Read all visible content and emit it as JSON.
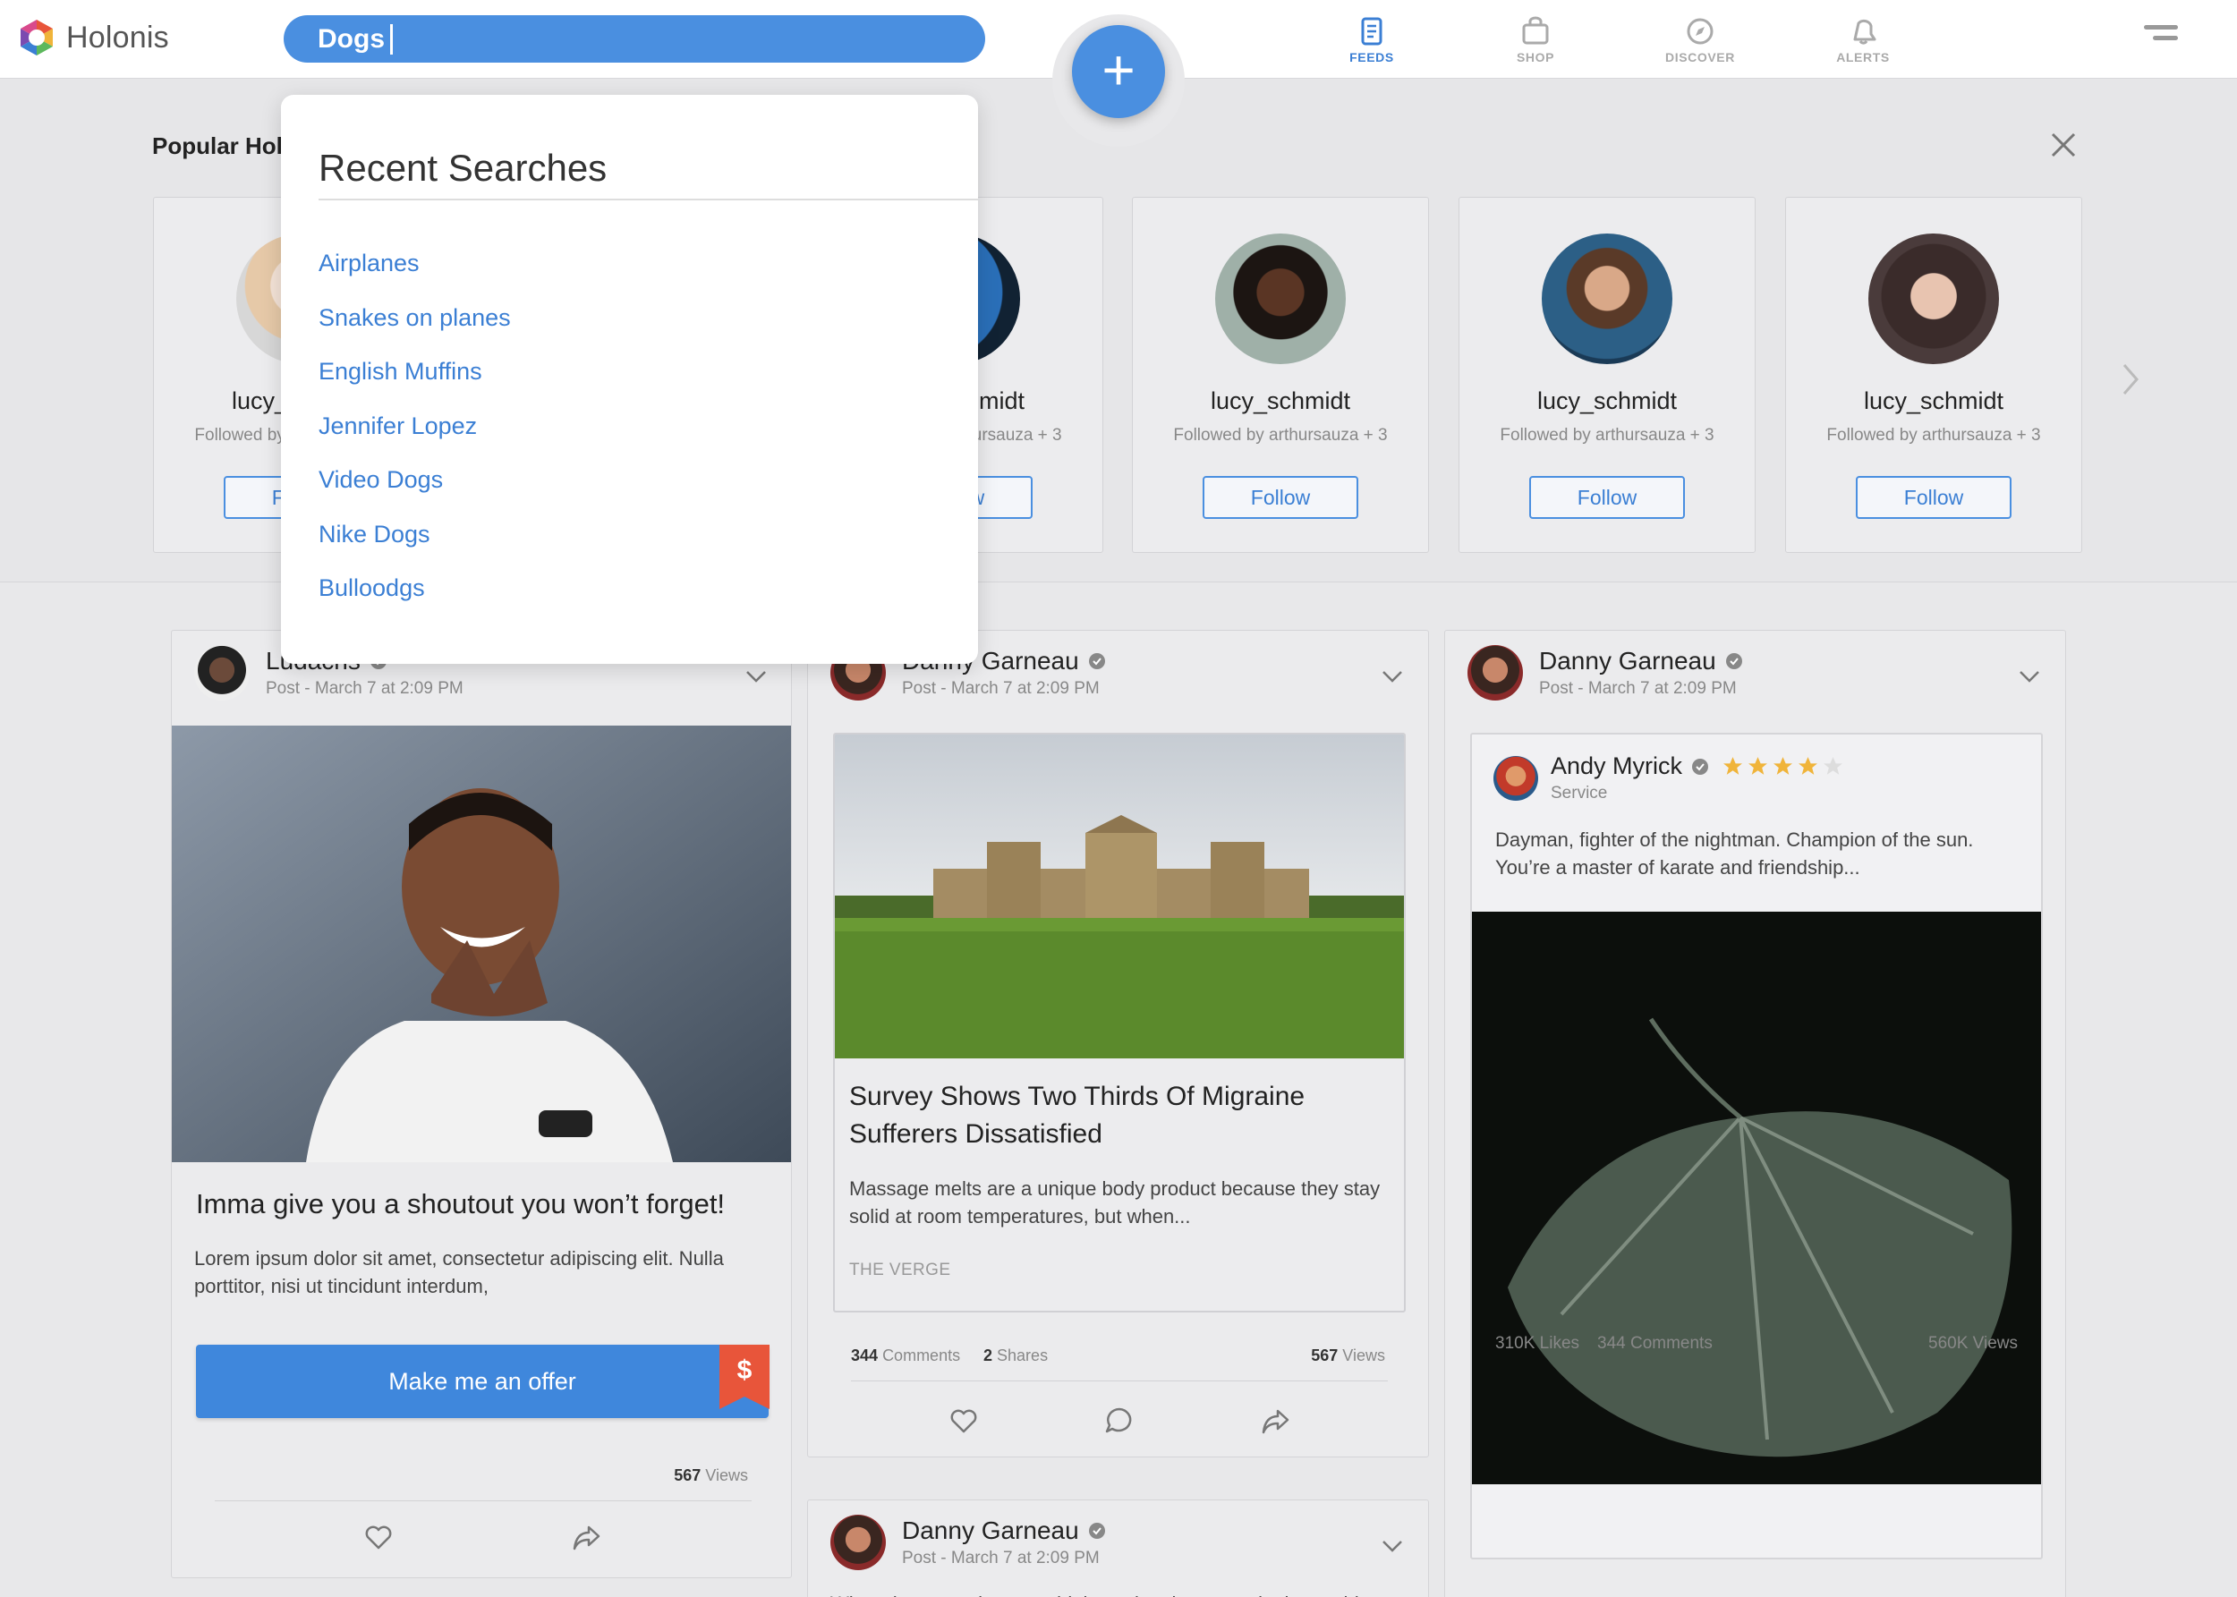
{
  "app": {
    "name": "Holonis"
  },
  "search": {
    "query": "Dogs"
  },
  "fab": {
    "label": "+"
  },
  "nav": [
    {
      "label": "FEEDS",
      "icon": "feeds-icon",
      "active": true
    },
    {
      "label": "SHOP",
      "icon": "shop-icon",
      "active": false
    },
    {
      "label": "DISCOVER",
      "icon": "discover-icon",
      "active": false
    },
    {
      "label": "ALERTS",
      "icon": "alerts-icon",
      "active": false
    }
  ],
  "popular": {
    "title": "Popular Holonis Users",
    "users": [
      {
        "name": "lucy_schmidt",
        "followed": "Followed by arthursauza + 3",
        "follow_label": "Follow"
      },
      {
        "name": "lucy_schmidt",
        "followed": "Followed by arthursauza + 3",
        "follow_label": "Follow"
      },
      {
        "name": "lucy_schmidt",
        "followed": "Followed by arthursauza + 3",
        "follow_label": "Follow"
      },
      {
        "name": "lucy_schmidt",
        "followed": "Followed by arthursauza + 3",
        "follow_label": "Follow"
      },
      {
        "name": "lucy_schmidt",
        "followed": "Followed by arthursauza + 3",
        "follow_label": "Follow"
      },
      {
        "name": "lucy_schmidt",
        "followed": "Followed by arthursauza + 3",
        "follow_label": "Follow"
      }
    ]
  },
  "recent_searches": {
    "title": "Recent Searches",
    "items": [
      "Airplanes",
      "Snakes on planes",
      "English Muffins",
      "Jennifer Lopez",
      "Video Dogs",
      "Nike Dogs",
      "Bulloodgs"
    ]
  },
  "feed": {
    "post1": {
      "author": "Ludacris",
      "meta": "Post - March 7 at 2:09 PM",
      "title": "Imma give you a shoutout you won’t forget!",
      "body": "Lorem ipsum dolor sit amet, consectetur adipiscing elit. Nulla porttitor, nisi ut tincidunt interdum,",
      "offer_label": "Make me an offer",
      "price_symbol": "$",
      "views_count": "567",
      "views_label": "Views"
    },
    "post2": {
      "author": "Danny Garneau",
      "meta": "Post - March 7 at 2:09 PM",
      "article_title": "Survey Shows Two Thirds Of Migraine Sufferers Dissatisfied",
      "article_body": "Massage melts are a unique body product because they stay solid at room temperatures, but when...",
      "source": "THE VERGE",
      "comments_count": "344",
      "comments_label": "Comments",
      "shares_count": "2",
      "shares_label": "Shares",
      "views_count": "567",
      "views_label": "Views"
    },
    "post3": {
      "author": "Danny Garneau",
      "meta": "Post - March 7 at 2:09 PM",
      "reviewer": "Andy Myrick",
      "rating": 4,
      "rating_max": 5,
      "review_category": "Service",
      "review_text": "Dayman, fighter of the nightman. Champion of the sun. You’re a master of karate and friendship...",
      "likes": "310K Likes",
      "comments": "344 Comments",
      "views": "560K Views"
    },
    "post4": {
      "author": "Danny Garneau",
      "meta": "Post - March 7 at 2:09 PM",
      "teaser": "When the seventh most widely spoken language in the world..."
    }
  },
  "colors": {
    "accent": "#4a8fe0",
    "link": "#3b7fd4",
    "star": "#f0b43a",
    "tag": "#e8553a"
  }
}
